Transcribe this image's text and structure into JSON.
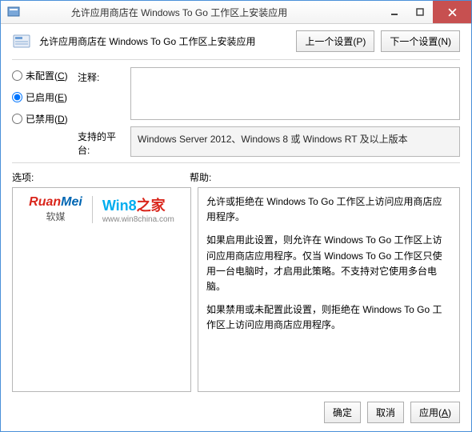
{
  "titlebar": {
    "title": "允许应用商店在 Windows To Go 工作区上安装应用"
  },
  "header": {
    "title": "允许应用商店在 Windows To Go 工作区上安装应用",
    "prev_label": "上一个设置(P)",
    "next_label": "下一个设置(N)"
  },
  "radios": {
    "not_configured": "未配置(C)",
    "enabled": "已启用(E)",
    "disabled": "已禁用(D)",
    "selected": "enabled"
  },
  "fields": {
    "comment_label": "注释:",
    "comment_value": "",
    "platform_label": "支持的平台:",
    "platform_value": "Windows Server 2012、Windows 8 或 Windows RT 及以上版本"
  },
  "panes": {
    "options_label": "选项:",
    "help_label": "帮助:"
  },
  "help": {
    "p1": "允许或拒绝在 Windows To Go 工作区上访问应用商店应用程序。",
    "p2": "如果启用此设置，则允许在 Windows To Go 工作区上访问应用商店应用程序。仅当 Windows To Go 工作区只使用一台电脑时，才启用此策略。不支持对它使用多台电脑。",
    "p3": "如果禁用或未配置此设置，则拒绝在 Windows To Go 工作区上访问应用商店应用程序。"
  },
  "logos": {
    "ruanmei_top_prefix": "Ruan",
    "ruanmei_top_suffix": "Mei",
    "ruanmei_bottom": "软媒",
    "win8_top_prefix": "Win8",
    "win8_top_suffix": "之家",
    "win8_bottom": "www.win8china.com"
  },
  "footer": {
    "ok": "确定",
    "cancel": "取消",
    "apply": "应用(A)"
  }
}
